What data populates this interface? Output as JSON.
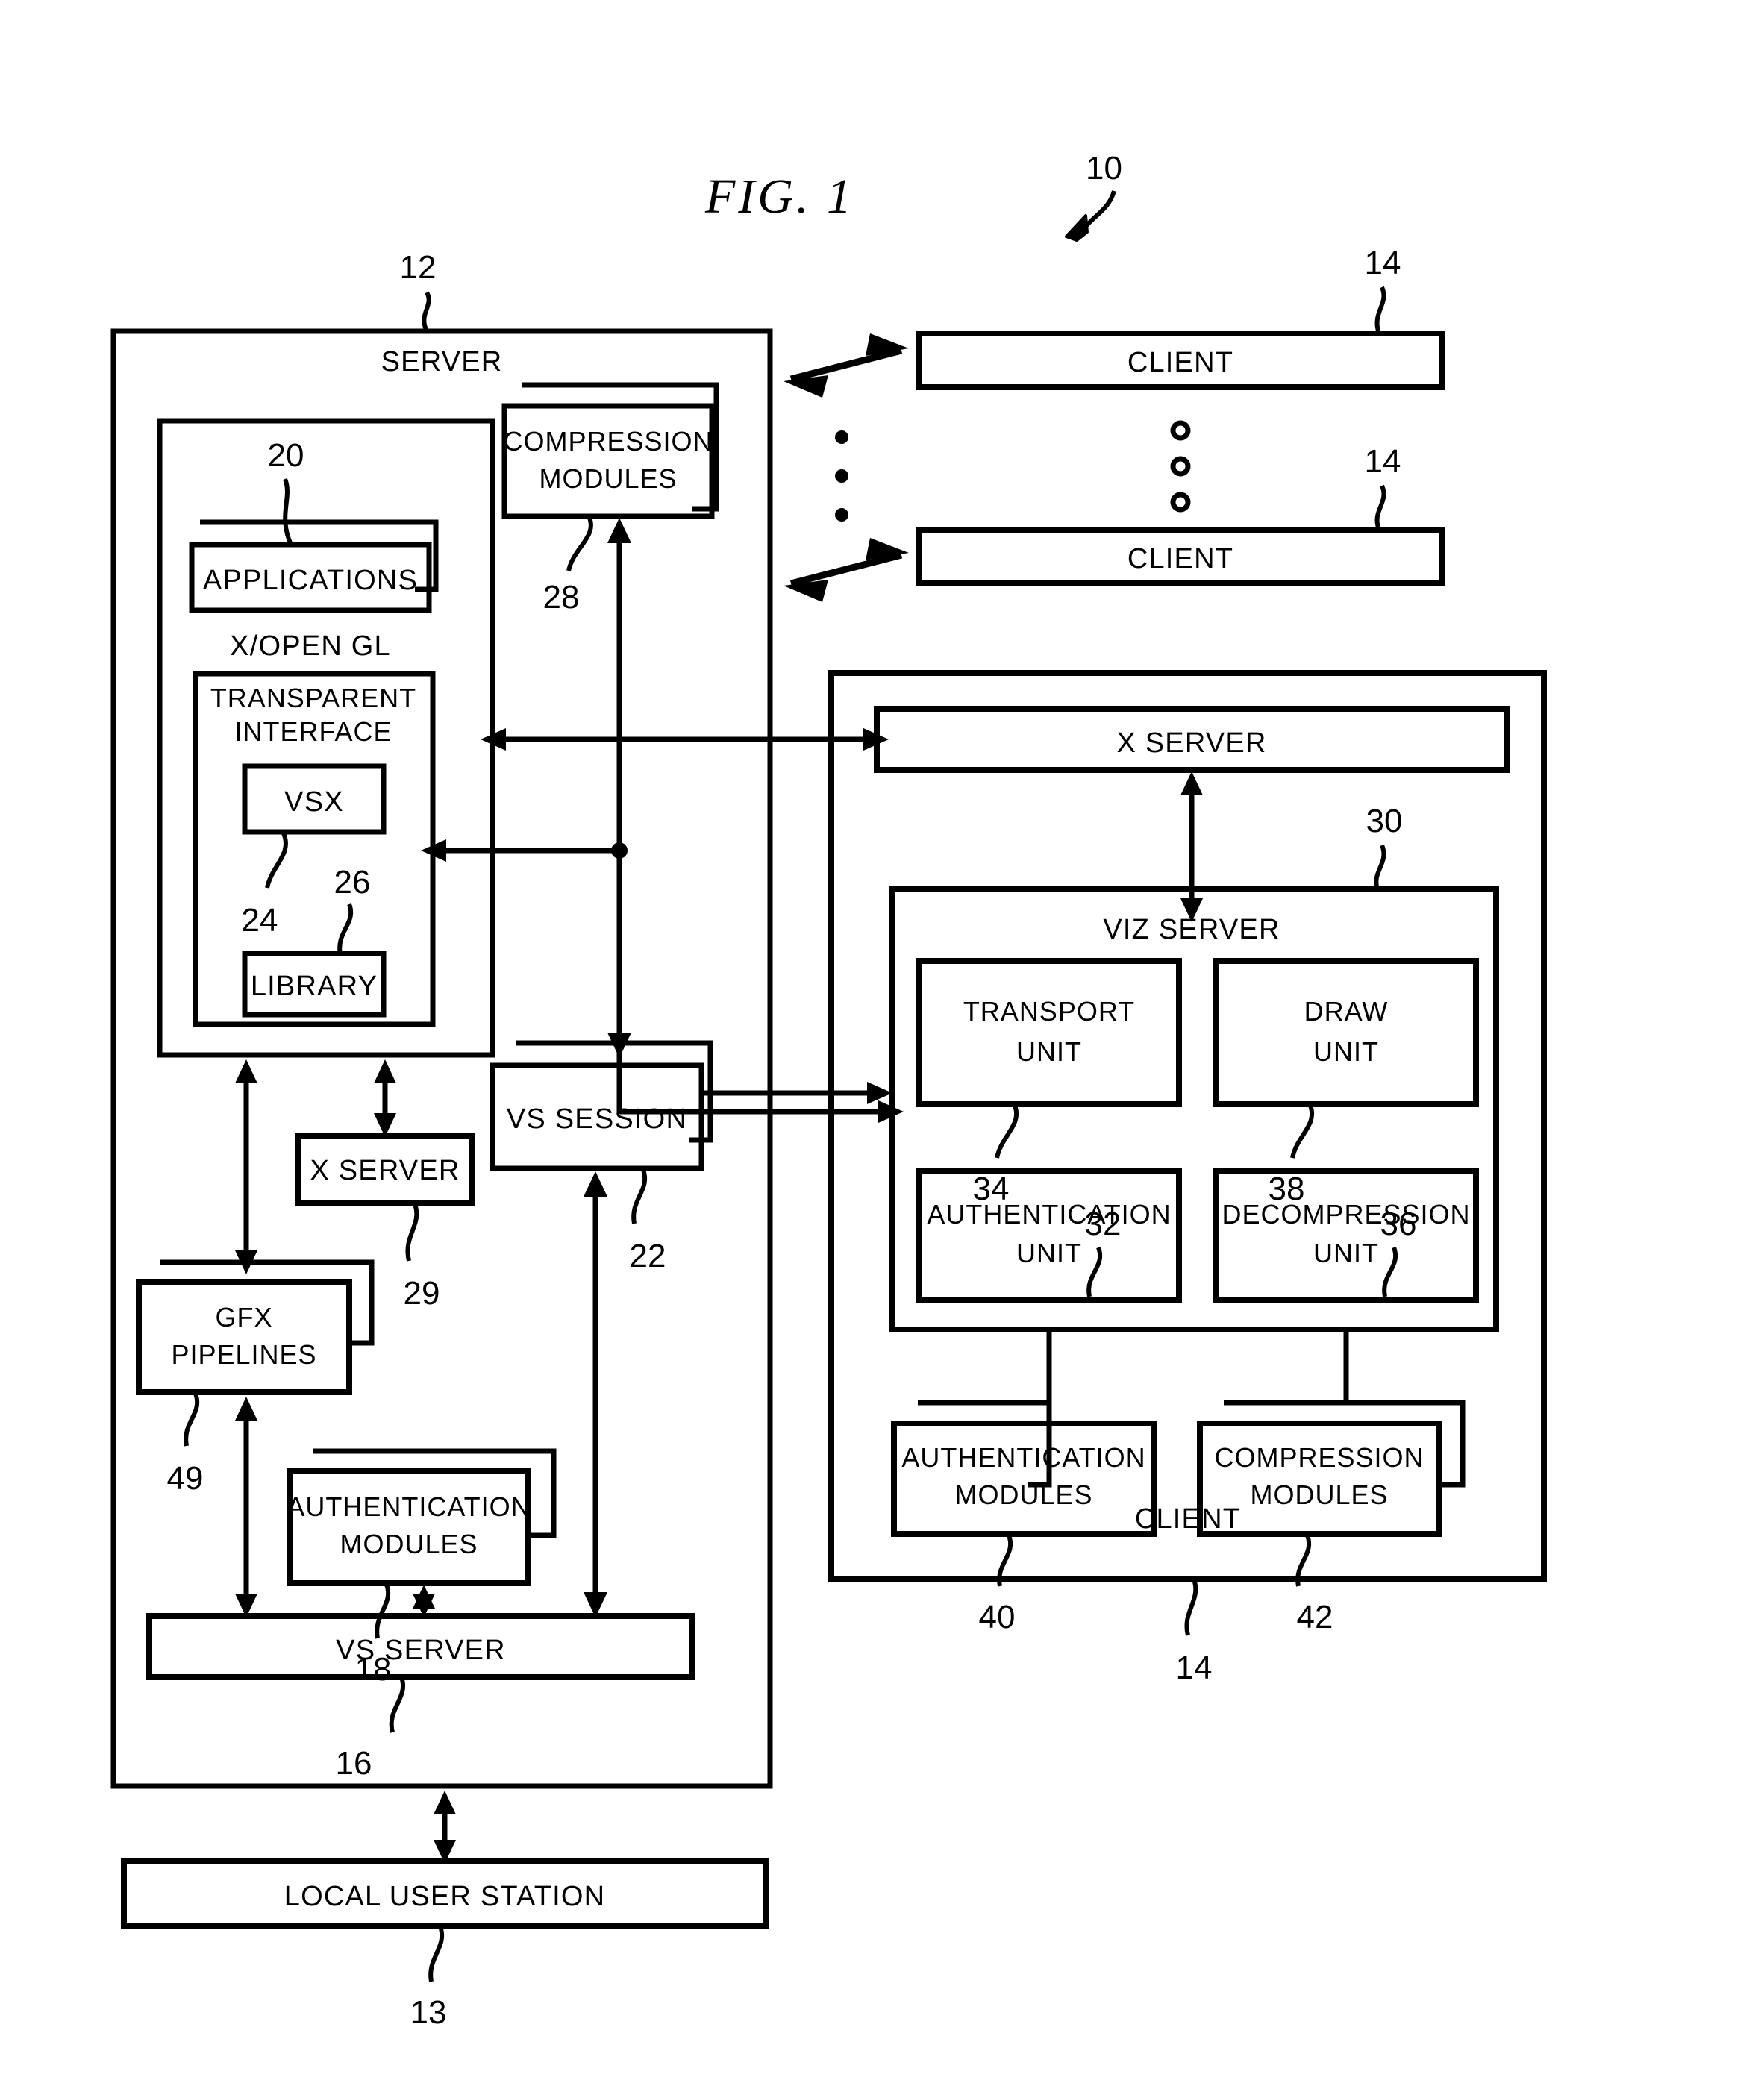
{
  "figure": {
    "title": "FIG.  1",
    "system_ref": "10"
  },
  "server": {
    "label": "SERVER",
    "ref": "12",
    "inner_panel": {
      "applications": {
        "label": "APPLICATIONS",
        "ref": "20"
      },
      "xopengl_label": "X/OPEN GL",
      "transparent_interface": {
        "label_line1": "TRANSPARENT",
        "label_line2": "INTERFACE",
        "vsx": {
          "label": "VSX",
          "ref": "24"
        },
        "library": {
          "label": "LIBRARY",
          "ref": "26"
        }
      }
    },
    "compression_modules": {
      "label_line1": "COMPRESSION",
      "label_line2": "MODULES",
      "ref": "28"
    },
    "vs_session": {
      "label": "VS SESSION",
      "ref": "22"
    },
    "x_server": {
      "label": "X  SERVER",
      "ref": "29"
    },
    "gfx_pipelines": {
      "label_line1": "GFX",
      "label_line2": "PIPELINES",
      "ref": "49"
    },
    "authentication_modules": {
      "label_line1": "AUTHENTICATION",
      "label_line2": "MODULES",
      "ref": "18"
    },
    "vs_server": {
      "label": "VS SERVER",
      "ref": "16"
    }
  },
  "local_user_station": {
    "label": "LOCAL USER STATION",
    "ref": "13"
  },
  "clients_top": [
    {
      "label": "CLIENT",
      "ref": "14"
    },
    {
      "label": "CLIENT",
      "ref": "14"
    }
  ],
  "vertical_ellipsis": "•",
  "client_detail": {
    "label": "CLIENT",
    "ref": "14",
    "x_server": {
      "label": "X SERVER"
    },
    "viz_server": {
      "label": "VIZ SERVER",
      "ref": "30",
      "transport_unit": {
        "label_line1": "TRANSPORT",
        "label_line2": "UNIT",
        "ref": "34"
      },
      "draw_unit": {
        "label_line1": "DRAW",
        "label_line2": "UNIT",
        "ref": "38"
      },
      "authentication_unit": {
        "label_line1": "AUTHENTICATION",
        "label_line2": "UNIT",
        "ref": "32"
      },
      "decompression_unit": {
        "label_line1": "DECOMPRESSION",
        "label_line2": "UNIT",
        "ref": "36"
      }
    },
    "authentication_modules": {
      "label_line1": "AUTHENTICATION",
      "label_line2": "MODULES",
      "ref": "40"
    },
    "compression_modules": {
      "label_line1": "COMPRESSION",
      "label_line2": "MODULES",
      "ref": "42"
    }
  },
  "colors": {
    "ink": "#000000",
    "paper": "#ffffff"
  }
}
